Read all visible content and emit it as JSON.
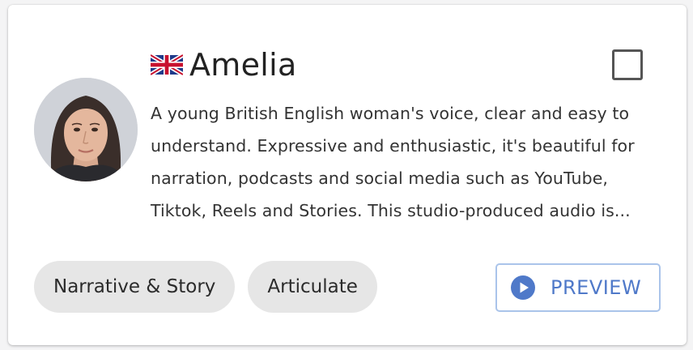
{
  "voice": {
    "flag_icon": "uk-flag-icon",
    "name": "Amelia",
    "description": "A young British English woman's voice, clear and easy to understand. Expressive and enthusiastic, it's beautiful for narration, podcasts and social media such as YouTube, Tiktok, Reels and Stories. This studio-produced audio is...",
    "selected": false
  },
  "tags": [
    {
      "label": "Narrative & Story"
    },
    {
      "label": "Articulate"
    }
  ],
  "preview_button": {
    "icon": "play-icon",
    "label": "PREVIEW"
  },
  "colors": {
    "accent": "#4f79c9",
    "tag_background": "#e6e6e6",
    "preview_border": "#aac4ea"
  }
}
